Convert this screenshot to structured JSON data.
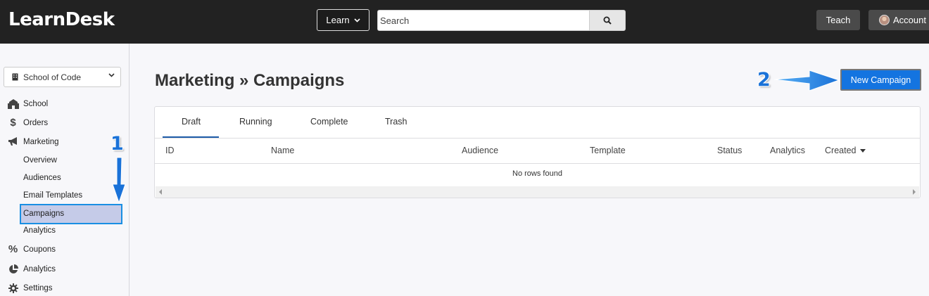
{
  "header": {
    "brand": "LearnDesk",
    "learn_label": "Learn",
    "search_placeholder": "Search",
    "teach_label": "Teach",
    "account_label": "Account"
  },
  "sidebar": {
    "school_select": "School of Code",
    "items": [
      {
        "label": "School",
        "icon": "building-icon"
      },
      {
        "label": "Orders",
        "icon": "dollar-icon"
      },
      {
        "label": "Marketing",
        "icon": "bullhorn-icon"
      },
      {
        "label": "Coupons",
        "icon": "percent-icon"
      },
      {
        "label": "Analytics",
        "icon": "pie-chart-icon"
      },
      {
        "label": "Settings",
        "icon": "gear-icon"
      }
    ],
    "marketing_sub": [
      "Overview",
      "Audiences",
      "Email Templates",
      "Campaigns",
      "Analytics"
    ],
    "active_sub": "Campaigns"
  },
  "main": {
    "title": "Marketing » Campaigns",
    "new_campaign_label": "New Campaign",
    "tabs": [
      "Draft",
      "Running",
      "Complete",
      "Trash"
    ],
    "active_tab": "Draft",
    "columns": [
      "ID",
      "Name",
      "Audience",
      "Template",
      "Status",
      "Analytics",
      "Created"
    ],
    "sorted_column": "Created",
    "empty_text": "No rows found"
  },
  "annotations": {
    "step1": "1",
    "step2": "2",
    "color": "#1a72d8"
  },
  "colors": {
    "topbar": "#222222",
    "primary_button": "#1474e0",
    "active_sub_bg": "#c5cbe8",
    "highlight_border": "#1a8fe3"
  }
}
